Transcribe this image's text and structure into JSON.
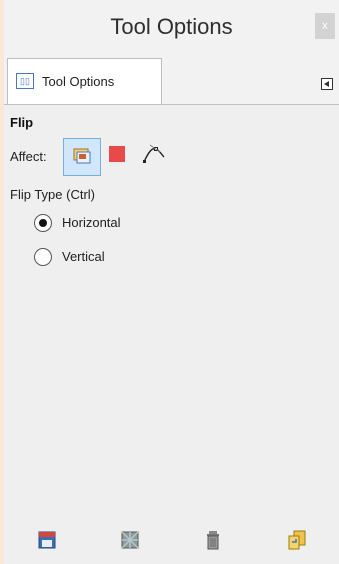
{
  "window": {
    "title": "Tool Options",
    "close_label": "x"
  },
  "tab": {
    "label": "Tool Options",
    "icon": "tool-options-icon"
  },
  "panel_menu": {
    "icon": "panel-menu-icon"
  },
  "flip": {
    "section_title": "Flip",
    "affect_label": "Affect:",
    "affect_options": [
      {
        "icon": "layer-icon",
        "selected": true
      },
      {
        "icon": "selection-icon",
        "selected": false,
        "color": "#e84a4a"
      },
      {
        "icon": "path-icon",
        "selected": false
      }
    ],
    "flip_type_label": "Flip Type  (Ctrl)",
    "flip_types": [
      {
        "label": "Horizontal",
        "checked": true
      },
      {
        "label": "Vertical",
        "checked": false
      }
    ]
  },
  "bottom_buttons": [
    {
      "icon": "save-options-icon"
    },
    {
      "icon": "restore-options-icon"
    },
    {
      "icon": "delete-options-icon"
    },
    {
      "icon": "reset-options-icon"
    }
  ]
}
